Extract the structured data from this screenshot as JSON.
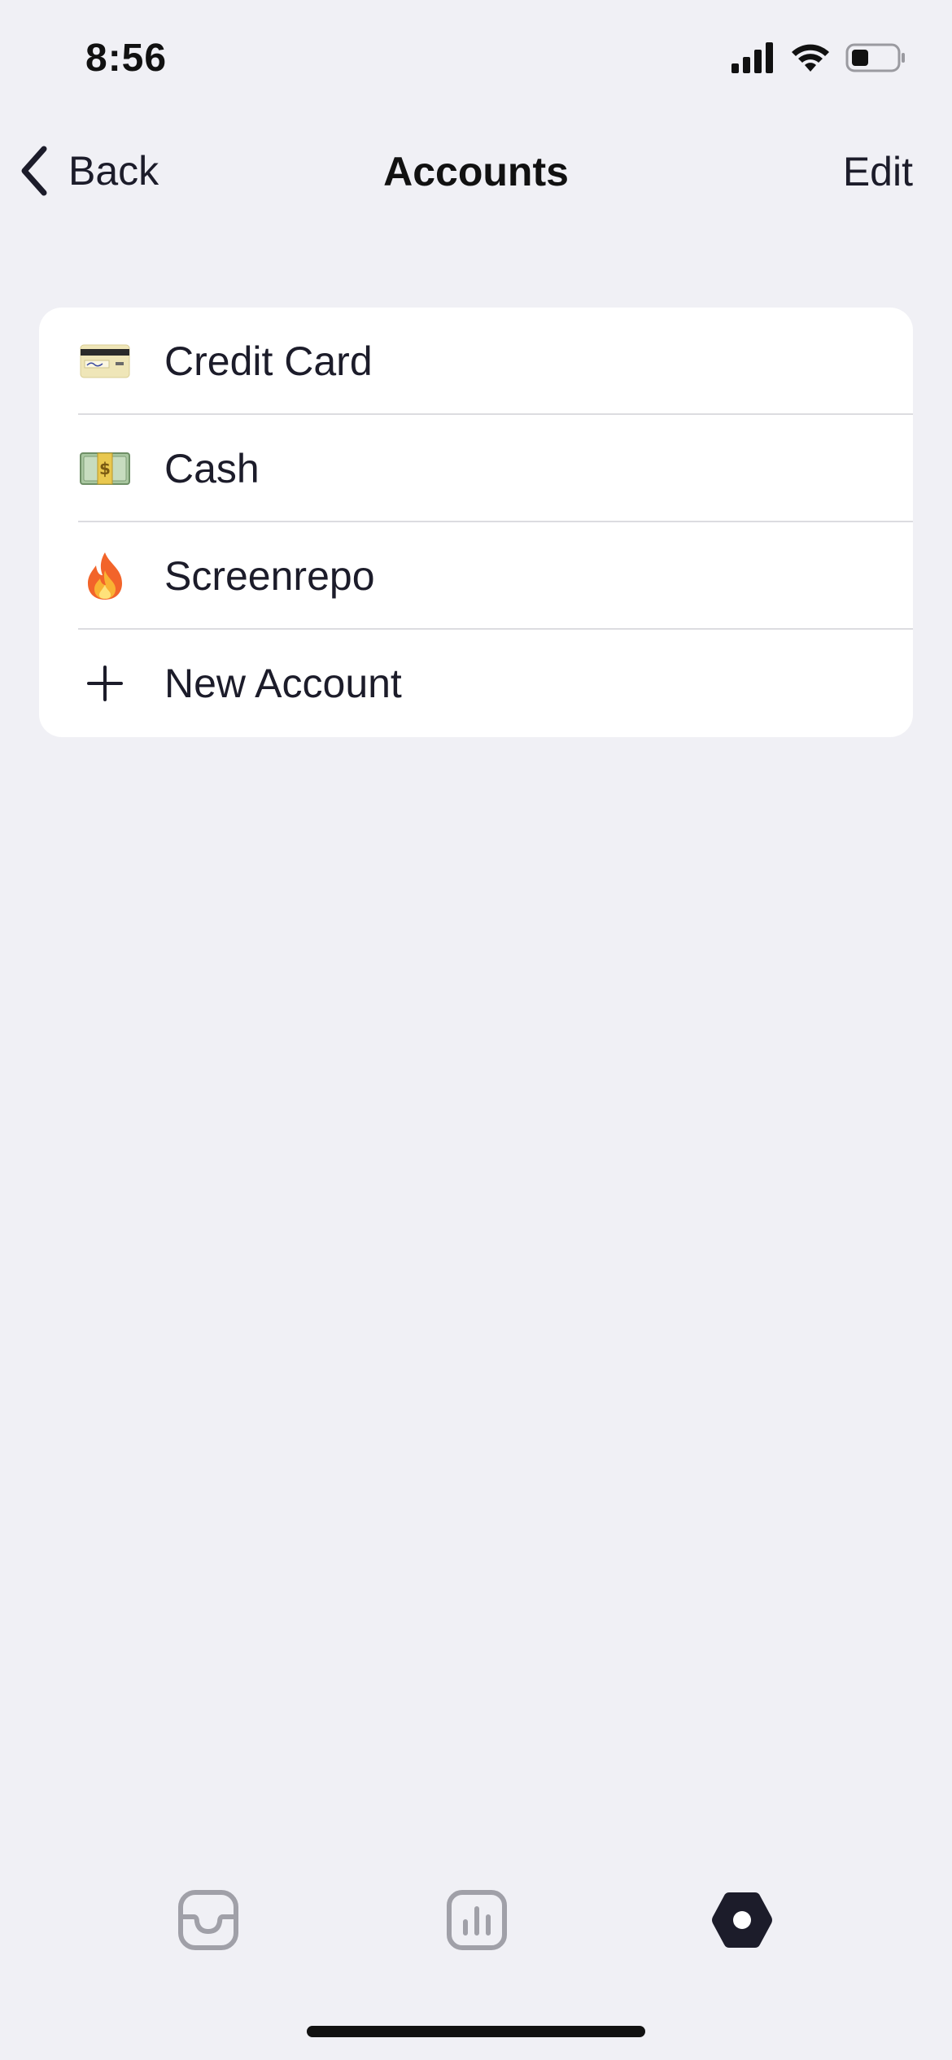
{
  "status_bar": {
    "time": "8:56"
  },
  "nav": {
    "back_label": "Back",
    "title": "Accounts",
    "edit_label": "Edit"
  },
  "accounts": [
    {
      "label": "Credit Card",
      "icon": "credit-card-icon"
    },
    {
      "label": "Cash",
      "icon": "money-bills-icon"
    },
    {
      "label": "Screenrepo",
      "icon": "fire-icon"
    }
  ],
  "new_account": {
    "label": "New Account",
    "icon": "plus-icon"
  },
  "tab_bar": {
    "tabs": [
      {
        "icon": "inbox-tray-icon",
        "active": false
      },
      {
        "icon": "bar-chart-icon",
        "active": false
      },
      {
        "icon": "settings-hexagon-icon",
        "active": true
      }
    ]
  },
  "colors": {
    "background": "#f0f0f5",
    "card": "#ffffff",
    "text": "#1c1c2a",
    "inactive_icon": "#a0a0a8",
    "active_icon": "#1c1c2a"
  }
}
